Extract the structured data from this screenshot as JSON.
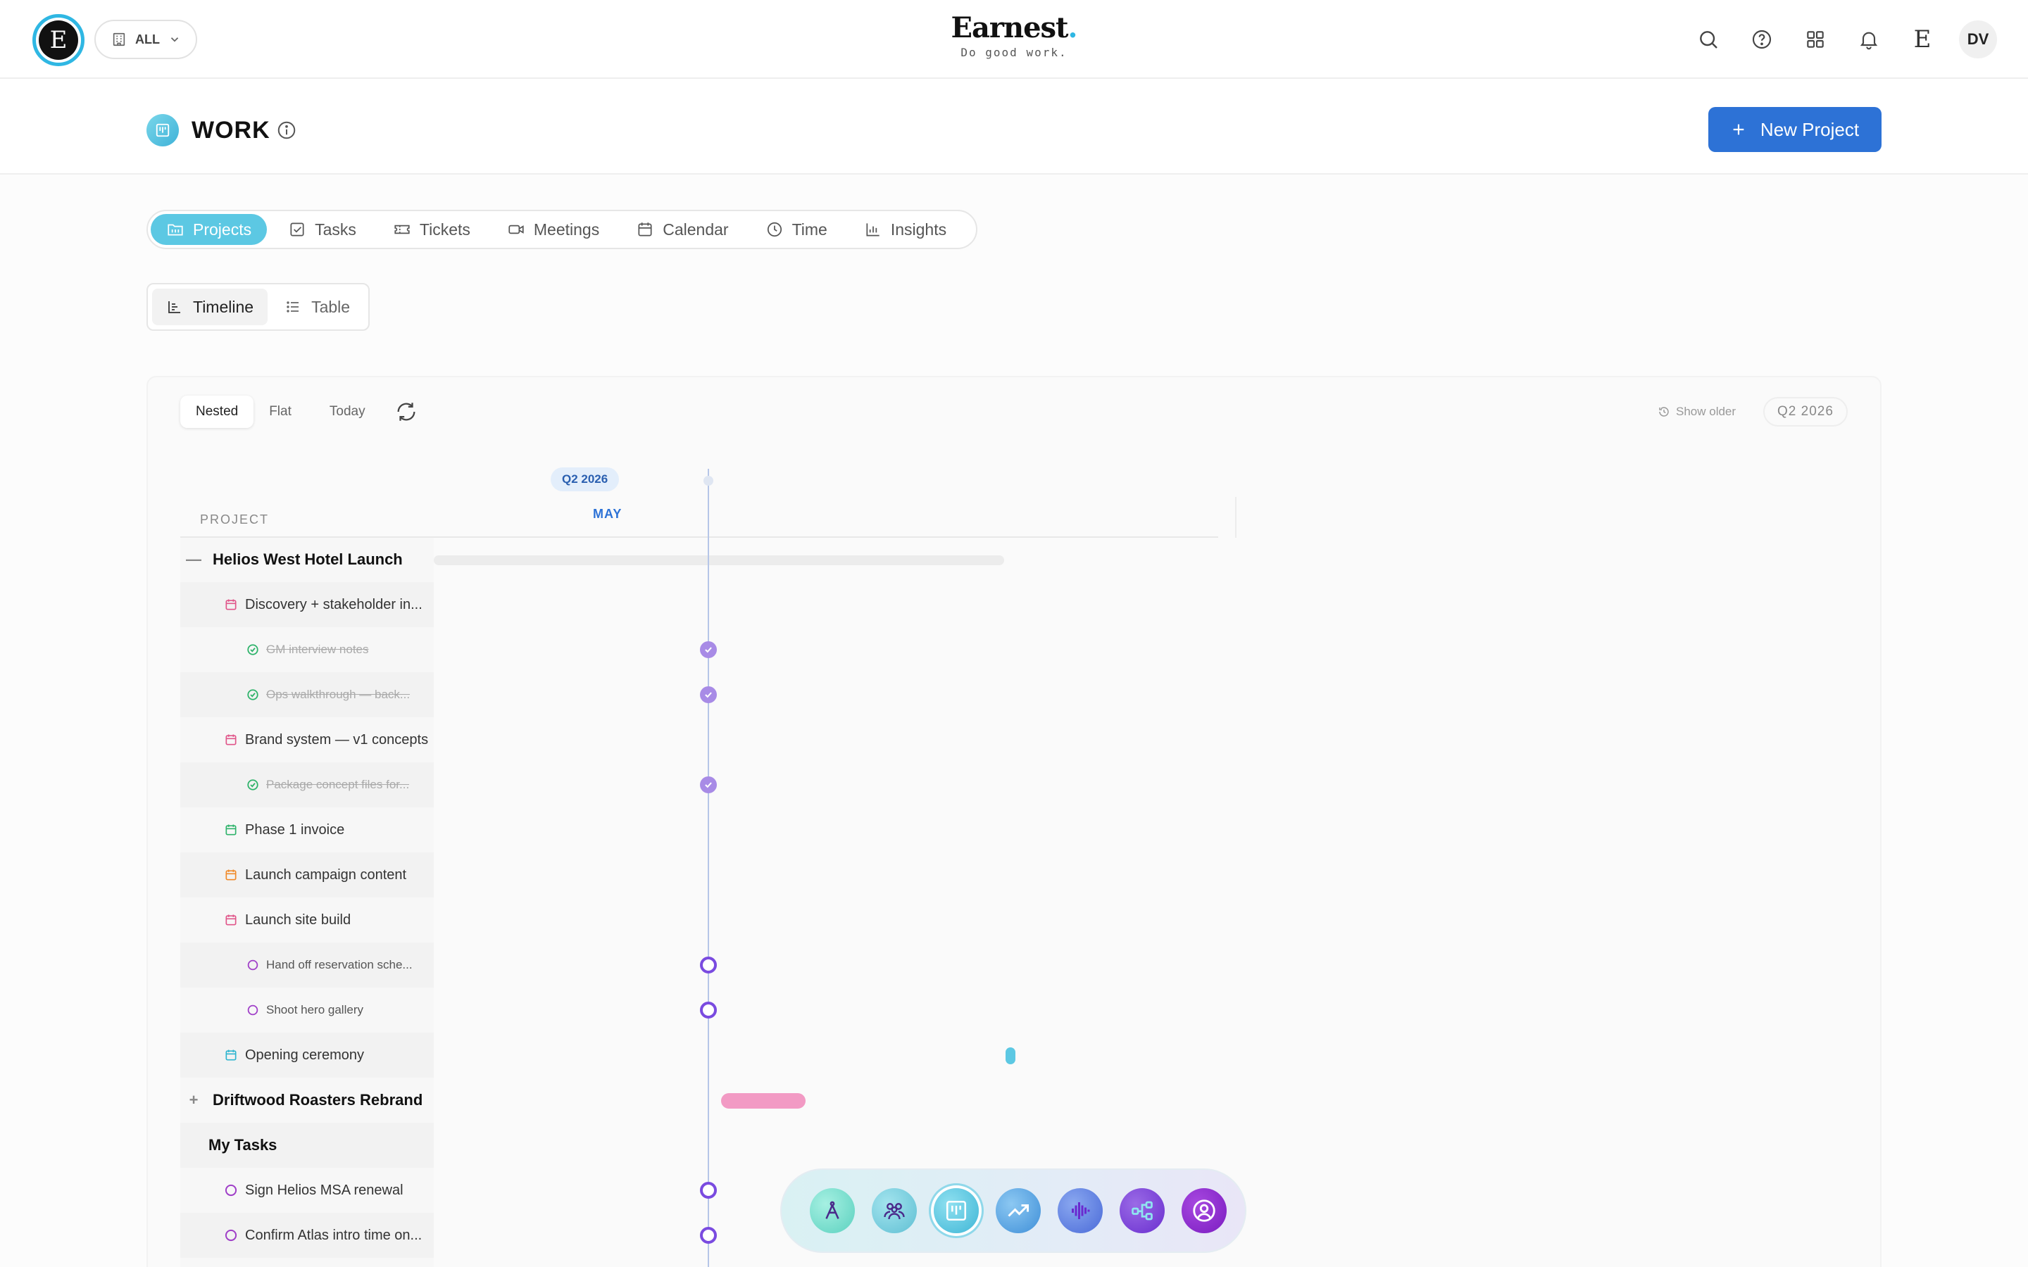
{
  "header": {
    "logo_letter": "E",
    "workspace_label": "ALL",
    "brand_name": "Earnest",
    "brand_dot": ".",
    "brand_tagline": "Do good work.",
    "right_letter": "E",
    "avatar_initials": "DV"
  },
  "page": {
    "title": "WORK",
    "new_project_label": "New Project"
  },
  "tabs": [
    {
      "label": "Projects",
      "icon": "folder-icon",
      "active": true
    },
    {
      "label": "Tasks",
      "icon": "checkbox-icon"
    },
    {
      "label": "Tickets",
      "icon": "ticket-icon"
    },
    {
      "label": "Meetings",
      "icon": "video-icon"
    },
    {
      "label": "Calendar",
      "icon": "calendar-icon"
    },
    {
      "label": "Time",
      "icon": "clock-icon"
    },
    {
      "label": "Insights",
      "icon": "bar-chart-icon"
    }
  ],
  "views": [
    {
      "label": "Timeline",
      "active": true
    },
    {
      "label": "Table"
    }
  ],
  "timeline": {
    "modes": [
      "Nested",
      "Flat"
    ],
    "active_mode": "Nested",
    "today_label": "Today",
    "show_older_label": "Show older",
    "quarter_pill": "Q2 2026",
    "quarter_badge": "Q2 2026",
    "month_label": "MAY",
    "column_header": "PROJECT",
    "rows": [
      {
        "label": "Helios West Hotel Launch",
        "kind": "project",
        "toggle": "—"
      },
      {
        "label": "Discovery + stakeholder in...",
        "kind": "milestone",
        "icon_color": "#e0568a"
      },
      {
        "label": "GM interview notes",
        "kind": "task-done"
      },
      {
        "label": "Ops walkthrough — back...",
        "kind": "task-done"
      },
      {
        "label": "Brand system — v1 concepts",
        "kind": "milestone",
        "icon_color": "#e0568a"
      },
      {
        "label": "Package concept files for...",
        "kind": "task-done"
      },
      {
        "label": "Phase 1 invoice",
        "kind": "milestone",
        "icon_color": "#2fb36b"
      },
      {
        "label": "Launch campaign content",
        "kind": "milestone",
        "icon_color": "#f08a2a"
      },
      {
        "label": "Launch site build",
        "kind": "milestone",
        "icon_color": "#e0568a"
      },
      {
        "label": "Hand off reservation sche...",
        "kind": "task-open"
      },
      {
        "label": "Shoot hero gallery",
        "kind": "task-open"
      },
      {
        "label": "Opening ceremony",
        "kind": "milestone",
        "icon_color": "#2fb5cf"
      },
      {
        "label": "Driftwood Roasters Rebrand",
        "kind": "project",
        "toggle": "+"
      },
      {
        "label": "My Tasks",
        "kind": "group"
      },
      {
        "label": "Sign Helios MSA renewal",
        "kind": "my-task"
      },
      {
        "label": "Confirm Atlas intro time on...",
        "kind": "my-task"
      }
    ]
  },
  "dock": [
    {
      "name": "compass-app-icon",
      "color": "#6fd6c5"
    },
    {
      "name": "people-app-icon",
      "color": "#6fc8d6"
    },
    {
      "name": "work-app-icon",
      "color": "#45bcd9",
      "active": true
    },
    {
      "name": "growth-app-icon",
      "color": "#4fa2e0"
    },
    {
      "name": "voice-app-icon",
      "color": "#5b86e0"
    },
    {
      "name": "network-app-icon",
      "color": "#7b46d8"
    },
    {
      "name": "profile-app-icon",
      "color": "#8a2dc9"
    }
  ]
}
